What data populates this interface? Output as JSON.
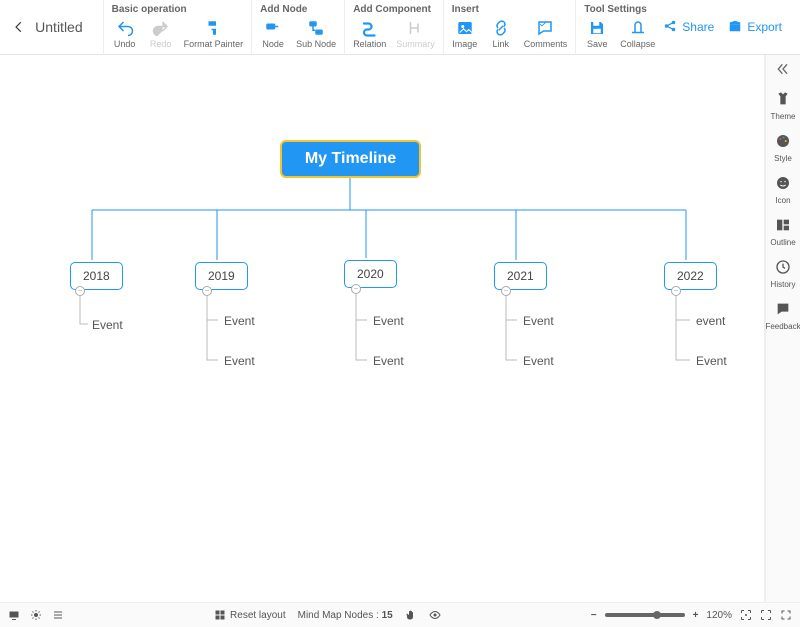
{
  "header": {
    "title": "Untitled",
    "groups": {
      "basic": {
        "label": "Basic operation",
        "undo": "Undo",
        "redo": "Redo",
        "format_painter": "Format Painter"
      },
      "add_node": {
        "label": "Add Node",
        "node": "Node",
        "sub_node": "Sub Node"
      },
      "add_component": {
        "label": "Add Component",
        "relation": "Relation",
        "summary": "Summary"
      },
      "insert": {
        "label": "Insert",
        "image": "Image",
        "link": "Link",
        "comments": "Comments"
      },
      "tool_settings": {
        "label": "Tool Settings",
        "save": "Save",
        "collapse": "Collapse"
      }
    },
    "share": "Share",
    "export": "Export"
  },
  "sidepanel": {
    "theme": "Theme",
    "style": "Style",
    "icon": "Icon",
    "outline": "Outline",
    "history": "History",
    "feedback": "Feedback"
  },
  "bottombar": {
    "reset_layout": "Reset layout",
    "nodes_label": "Mind Map Nodes :",
    "nodes_count": "15",
    "zoom_pct": "120%"
  },
  "chart_data": {
    "type": "tree",
    "root": "My Timeline",
    "years": [
      {
        "label": "2018",
        "events": [
          "Event"
        ]
      },
      {
        "label": "2019",
        "events": [
          "Event",
          "Event"
        ]
      },
      {
        "label": "2020",
        "events": [
          "Event",
          "Event"
        ]
      },
      {
        "label": "2021",
        "events": [
          "Event",
          "Event"
        ]
      },
      {
        "label": "2022",
        "events": [
          "event",
          "Event"
        ]
      }
    ]
  }
}
